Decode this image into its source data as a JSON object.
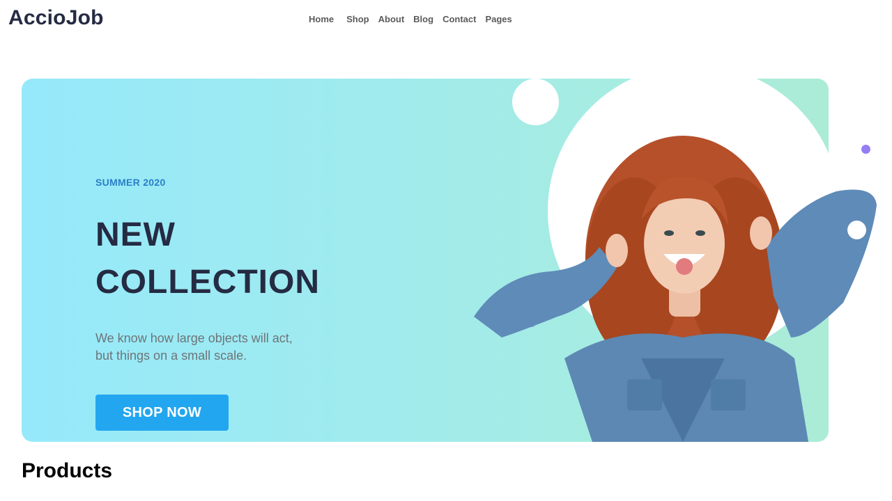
{
  "header": {
    "logo": "AccioJob",
    "nav": [
      "Home",
      "Shop",
      "About",
      "Blog",
      "Contact",
      "Pages"
    ]
  },
  "hero": {
    "season": "SUMMER 2020",
    "title_line1": "NEW",
    "title_line2": "COLLECTION",
    "description_line1": "We know how large objects will act,",
    "description_line2": "but things on a small scale.",
    "cta": "SHOP NOW",
    "image_alt": "smiling-woman-curly-red-hair-denim-shirt"
  },
  "section": {
    "products_title": "Products"
  },
  "colors": {
    "brand_dark": "#252b42",
    "accent_blue": "#23a6f0",
    "season_blue": "#2a7fc6",
    "hero_gradient_start": "#96e9fb",
    "hero_gradient_end": "#abecd6",
    "purple_dot": "#977df4"
  }
}
